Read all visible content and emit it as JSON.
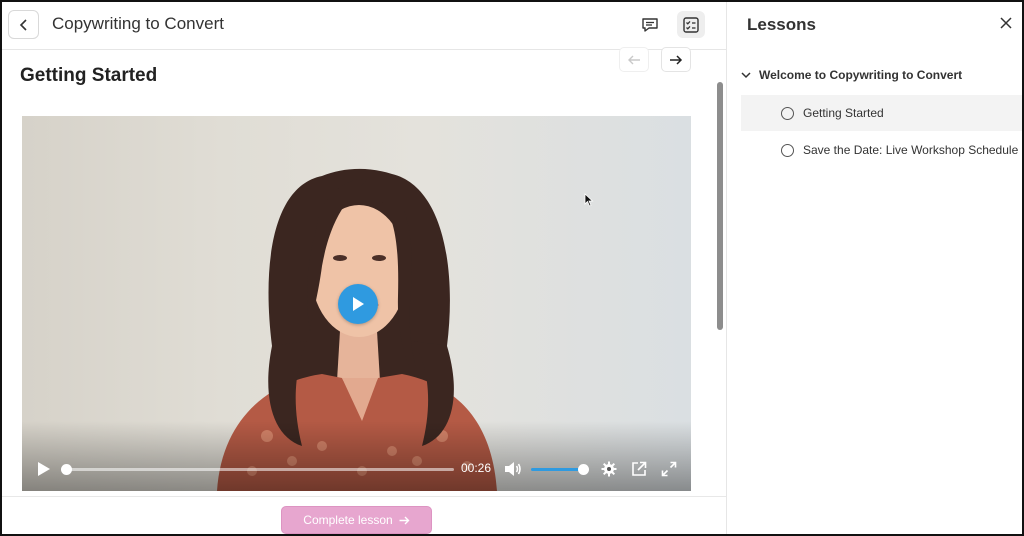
{
  "header": {
    "course_title": "Copywriting to Convert",
    "back_icon": "chevron-left-icon",
    "comments_icon": "comment-icon",
    "lessons_toggle_icon": "checklist-icon"
  },
  "lesson": {
    "title": "Getting Started",
    "prev_icon": "arrow-left-icon",
    "next_icon": "arrow-right-icon"
  },
  "video": {
    "current_time": "00:26",
    "progress": 0.0,
    "volume": 1.0,
    "accent_color": "#2f9ae0"
  },
  "footer": {
    "complete_label": "Complete lesson",
    "complete_color": "#e7a6cf"
  },
  "sidebar": {
    "title": "Lessons",
    "section_title": "Welcome to Copywriting to Convert",
    "items": [
      {
        "label": "Getting Started",
        "active": true
      },
      {
        "label": "Save the Date: Live Workshop Schedule",
        "active": false
      }
    ]
  }
}
